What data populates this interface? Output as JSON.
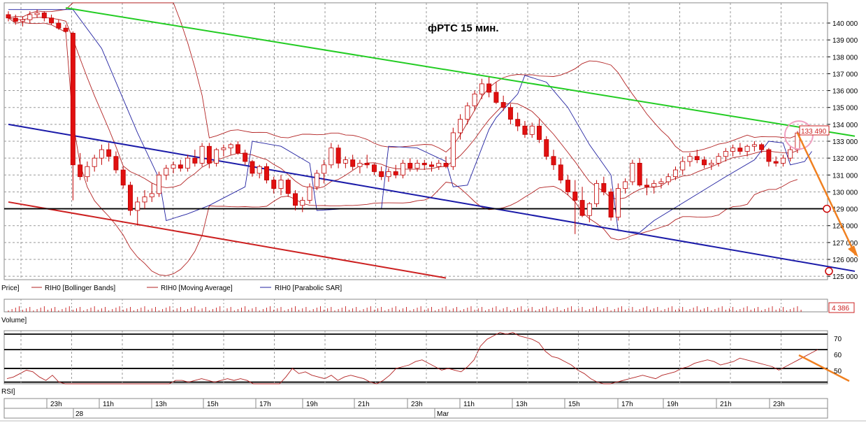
{
  "chart_data": {
    "type": "candlestick",
    "title": "фРТС   15 мин.",
    "price_panel": {
      "label": "Price]",
      "ylim": [
        124800,
        141200
      ],
      "y_ticks": [
        {
          "v": 125000,
          "label": "125 000"
        },
        {
          "v": 126000,
          "label": "126 000"
        },
        {
          "v": 127000,
          "label": "127 000"
        },
        {
          "v": 128000,
          "label": "128 000"
        },
        {
          "v": 129000,
          "label": "129 000"
        },
        {
          "v": 130000,
          "label": "130 000"
        },
        {
          "v": 131000,
          "label": "131 000"
        },
        {
          "v": 132000,
          "label": "132 000"
        },
        {
          "v": 133000,
          "label": "133 000"
        },
        {
          "v": 134000,
          "label": "134 000"
        },
        {
          "v": 135000,
          "label": "135 000"
        },
        {
          "v": 136000,
          "label": "136 000"
        },
        {
          "v": 137000,
          "label": "137 000"
        },
        {
          "v": 138000,
          "label": "138 000"
        },
        {
          "v": 139000,
          "label": "139 000"
        },
        {
          "v": 140000,
          "label": "140 000"
        }
      ],
      "last_price_label": "133 490",
      "last_price": 133490,
      "legend": [
        {
          "name": "RIH0 [Bollinger Bands]",
          "color": "#b22222"
        },
        {
          "name": "RIH0 [Moving Average]",
          "color": "#b22222"
        },
        {
          "name": "RIH0 [Parabolic SAR]",
          "color": "#2020a0"
        }
      ],
      "candles": [
        [
          140500,
          140700,
          140100,
          140300
        ],
        [
          140300,
          140500,
          139900,
          140100
        ],
        [
          140100,
          140400,
          139800,
          140200
        ],
        [
          140200,
          140700,
          140000,
          140500
        ],
        [
          140500,
          140800,
          140300,
          140600
        ],
        [
          140600,
          140700,
          140100,
          140300
        ],
        [
          140300,
          140500,
          139900,
          140000
        ],
        [
          140000,
          140200,
          139600,
          139700
        ],
        [
          139700,
          139900,
          139400,
          139500
        ],
        [
          139400,
          139500,
          129500,
          131600
        ],
        [
          131600,
          132300,
          130700,
          130900
        ],
        [
          130900,
          131800,
          130600,
          131500
        ],
        [
          131500,
          132200,
          131200,
          132000
        ],
        [
          132000,
          132800,
          131600,
          132500
        ],
        [
          132500,
          132900,
          131800,
          132100
        ],
        [
          132100,
          132400,
          131100,
          131300
        ],
        [
          131300,
          131500,
          130200,
          130400
        ],
        [
          130400,
          130600,
          128600,
          128900
        ],
        [
          128900,
          129700,
          128000,
          129400
        ],
        [
          129400,
          130100,
          129000,
          129700
        ],
        [
          129700,
          130500,
          129400,
          129900
        ],
        [
          129900,
          131200,
          129700,
          131000
        ],
        [
          131000,
          131600,
          130700,
          131400
        ],
        [
          131400,
          131800,
          131100,
          131600
        ],
        [
          131600,
          131900,
          131200,
          131400
        ],
        [
          131400,
          132200,
          131200,
          132000
        ],
        [
          132000,
          132500,
          131500,
          131700
        ],
        [
          131700,
          132900,
          131500,
          132700
        ],
        [
          132700,
          132900,
          131400,
          131700
        ],
        [
          131700,
          132600,
          131500,
          132500
        ],
        [
          132500,
          132800,
          132100,
          132600
        ],
        [
          132600,
          132900,
          132200,
          132800
        ],
        [
          132800,
          133000,
          132200,
          132300
        ],
        [
          132300,
          132500,
          131600,
          131800
        ],
        [
          131800,
          131900,
          130900,
          131100
        ],
        [
          131100,
          131600,
          130800,
          131500
        ],
        [
          131500,
          131700,
          130500,
          130700
        ],
        [
          130700,
          130900,
          129900,
          130200
        ],
        [
          130200,
          131000,
          129800,
          130700
        ],
        [
          130700,
          130800,
          129700,
          129900
        ],
        [
          129900,
          130100,
          128900,
          129200
        ],
        [
          129200,
          129700,
          128800,
          129500
        ],
        [
          129500,
          130500,
          129300,
          130300
        ],
        [
          130300,
          131300,
          130100,
          131100
        ],
        [
          131100,
          131900,
          130500,
          131600
        ],
        [
          131600,
          132900,
          131400,
          132600
        ],
        [
          132600,
          132800,
          131400,
          131700
        ],
        [
          131700,
          132100,
          131400,
          131900
        ],
        [
          131900,
          132200,
          131300,
          131500
        ],
        [
          131500,
          131900,
          131100,
          131700
        ],
        [
          131700,
          132200,
          131400,
          131600
        ],
        [
          131600,
          131700,
          131000,
          131200
        ],
        [
          131200,
          131500,
          130700,
          130900
        ],
        [
          130900,
          131400,
          130600,
          131200
        ],
        [
          131200,
          131600,
          130800,
          131000
        ],
        [
          131000,
          131900,
          130800,
          131700
        ],
        [
          131700,
          132000,
          131200,
          131400
        ],
        [
          131400,
          131900,
          131200,
          131700
        ],
        [
          131700,
          131900,
          131300,
          131600
        ],
        [
          131600,
          131800,
          131200,
          131500
        ],
        [
          131500,
          131900,
          131300,
          131700
        ],
        [
          131700,
          132100,
          131400,
          131500
        ],
        [
          131500,
          133800,
          131300,
          133500
        ],
        [
          133500,
          134600,
          133100,
          134300
        ],
        [
          134300,
          135300,
          134000,
          135100
        ],
        [
          135100,
          136000,
          134800,
          135800
        ],
        [
          135800,
          136700,
          135500,
          136400
        ],
        [
          136400,
          136800,
          135600,
          135900
        ],
        [
          135900,
          136500,
          135200,
          135300
        ],
        [
          135300,
          135700,
          134800,
          135000
        ],
        [
          135000,
          135200,
          134000,
          134300
        ],
        [
          134300,
          134700,
          133600,
          133900
        ],
        [
          133900,
          134200,
          133200,
          133400
        ],
        [
          133400,
          134100,
          133200,
          133900
        ],
        [
          133900,
          134300,
          132900,
          133100
        ],
        [
          133100,
          133300,
          131900,
          132100
        ],
        [
          132100,
          132500,
          131300,
          131600
        ],
        [
          131600,
          132000,
          130500,
          130700
        ],
        [
          130700,
          131000,
          129800,
          130000
        ],
        [
          130000,
          130700,
          127500,
          129500
        ],
        [
          129500,
          130300,
          128500,
          128600
        ],
        [
          128600,
          129400,
          128200,
          129300
        ],
        [
          129300,
          130700,
          129100,
          130500
        ],
        [
          130500,
          130900,
          129800,
          130000
        ],
        [
          130000,
          130200,
          128300,
          128500
        ],
        [
          128500,
          130500,
          128300,
          130200
        ],
        [
          130200,
          130800,
          129900,
          130600
        ],
        [
          130600,
          131900,
          130400,
          131700
        ],
        [
          131700,
          132000,
          130300,
          130400
        ],
        [
          130400,
          130800,
          129800,
          130300
        ],
        [
          130300,
          130700,
          129900,
          130500
        ],
        [
          130500,
          130800,
          130200,
          130600
        ],
        [
          130600,
          131100,
          130400,
          130900
        ],
        [
          130900,
          131500,
          130700,
          131300
        ],
        [
          131300,
          132100,
          131000,
          131800
        ],
        [
          131800,
          132300,
          131500,
          132100
        ],
        [
          132100,
          132500,
          131700,
          131900
        ],
        [
          131900,
          132100,
          131400,
          131600
        ],
        [
          131600,
          131900,
          131300,
          131700
        ],
        [
          131700,
          132300,
          131500,
          132100
        ],
        [
          132100,
          132600,
          131800,
          132400
        ],
        [
          132400,
          132800,
          132100,
          132600
        ],
        [
          132600,
          132900,
          132200,
          132400
        ],
        [
          132400,
          132800,
          132100,
          132700
        ],
        [
          132700,
          133000,
          132400,
          132800
        ],
        [
          132800,
          132900,
          132300,
          132500
        ],
        [
          132500,
          132600,
          131500,
          131800
        ],
        [
          131800,
          132100,
          131500,
          131700
        ],
        [
          131700,
          132200,
          131500,
          132000
        ],
        [
          132000,
          132700,
          131800,
          132500
        ],
        [
          132500,
          133600,
          132300,
          133490
        ]
      ],
      "psar_points": [
        [
          0,
          140800
        ],
        [
          9,
          140800
        ],
        [
          13,
          138500
        ],
        [
          18,
          133500
        ],
        [
          21,
          130800
        ],
        [
          22,
          128300
        ],
        [
          25,
          128700
        ],
        [
          28,
          129200
        ],
        [
          33,
          130300
        ],
        [
          34,
          133000
        ],
        [
          38,
          132700
        ],
        [
          42,
          131700
        ],
        [
          43,
          128900
        ],
        [
          47,
          129000
        ],
        [
          52,
          129000
        ],
        [
          53,
          132700
        ],
        [
          57,
          132600
        ],
        [
          61,
          131800
        ],
        [
          62,
          130300
        ],
        [
          64,
          130400
        ],
        [
          67,
          133700
        ],
        [
          68,
          134400
        ],
        [
          71,
          135800
        ],
        [
          72,
          136900
        ],
        [
          75,
          136500
        ],
        [
          78,
          135000
        ],
        [
          81,
          132800
        ],
        [
          84,
          131000
        ],
        [
          85,
          127700
        ],
        [
          88,
          127600
        ],
        [
          90,
          128300
        ],
        [
          95,
          129600
        ],
        [
          100,
          130900
        ],
        [
          104,
          131900
        ],
        [
          106,
          133000
        ],
        [
          108,
          132900
        ],
        [
          109,
          131600
        ],
        [
          111,
          131800
        ],
        [
          112,
          132400
        ]
      ],
      "channel_lines": [
        {
          "name": "green",
          "color": "#22cc22",
          "from": [
            8,
            140900
          ],
          "to": [
            118,
            133300
          ]
        },
        {
          "name": "blue",
          "color": "#1a1aa8",
          "from": [
            0,
            134000
          ],
          "to": [
            118,
            125300
          ]
        },
        {
          "name": "red",
          "color": "#cc2020",
          "from": [
            0,
            129400
          ],
          "to": [
            61,
            124900
          ]
        },
        {
          "name": "black-horizontal",
          "color": "#000000",
          "value": 129000
        }
      ]
    },
    "volume_panel": {
      "label": "Volume]",
      "last_value_label": "4 386"
    },
    "rsi_panel": {
      "label": "RSI]",
      "ylim": [
        42,
        73
      ],
      "levels": [
        70,
        60,
        50
      ],
      "tick_labels": [
        "70",
        "60",
        "50"
      ],
      "lines": [
        71,
        62,
        51,
        43
      ],
      "values": [
        45,
        46,
        48,
        50,
        49,
        46,
        44,
        47,
        43,
        38,
        36,
        34,
        32,
        30,
        28,
        27,
        28,
        29,
        31,
        33,
        35,
        36,
        38,
        40,
        41,
        42,
        44,
        44,
        43,
        44,
        45,
        44,
        43,
        44,
        45,
        44,
        45,
        44,
        42,
        41,
        40,
        39,
        41,
        46,
        51,
        48,
        49,
        47,
        46,
        45,
        47,
        44,
        46,
        47,
        46,
        45,
        43,
        42,
        44,
        47,
        51,
        52,
        53,
        55,
        56,
        54,
        52,
        50,
        51,
        50,
        49,
        52,
        56,
        64,
        68,
        70,
        72,
        71,
        72,
        70,
        69,
        68,
        66,
        61,
        58,
        57,
        55,
        53,
        50,
        48,
        45,
        43,
        41,
        42,
        43,
        44,
        45,
        46,
        47,
        46,
        45,
        47,
        48,
        49,
        51,
        52,
        54,
        55,
        56,
        55,
        53,
        54,
        55,
        57,
        56,
        55,
        54,
        53,
        52,
        50,
        52,
        54,
        56,
        58,
        60,
        62
      ]
    },
    "x_axis": {
      "time_labels": [
        "23h",
        "11h",
        "13h",
        "15h",
        "17h",
        "19h",
        "21h",
        "23h",
        "11h",
        "13h",
        "15h",
        "17h",
        "19h",
        "21h",
        "23h"
      ],
      "date_labels": [
        "28",
        "Mar"
      ]
    },
    "annotations": {
      "circle_color": "#f0a0c0",
      "arrow_color": "#f08020",
      "marker_color": "#cc0000"
    }
  }
}
